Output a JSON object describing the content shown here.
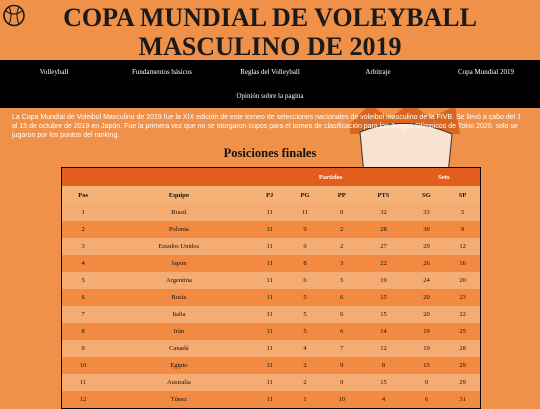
{
  "header": {
    "title": "COPA MUNDIAL DE VOLEYBALL MASCULINO DE 2019"
  },
  "nav": {
    "row1": [
      "Volleyball",
      "Fundamentos básicos",
      "Reglas del Volleyball",
      "Arbitraje",
      "Copa Mundial 2019"
    ],
    "row2": "Opinión sobre la pagina"
  },
  "intro": "La Copa Mundial de Voleibol Masculino de 2019 fue la XIX edición de este torneo de selecciones nacionales de voleibol masculino de la FIVB. Se llevó a cabo del 1 al 15 de octubre de 2019 en Japón. Fue la primera vez que no se otorgaron cupos para el torneo de clasificación para los Juegos Olímpicos de Tokio 2020, solo se jugaron por los puntos del ranking.",
  "standings": {
    "title": "Posiciones finales",
    "group_partidos": "Partidos",
    "group_sets": "Sets",
    "columns": [
      "Pos",
      "Equipo",
      "PJ",
      "PG",
      "PP",
      "PTS",
      "SG",
      "SP"
    ],
    "rows": [
      [
        "1",
        "Brasil",
        "11",
        "11",
        "0",
        "32",
        "33",
        "5"
      ],
      [
        "2",
        "Polonia",
        "11",
        "9",
        "2",
        "28",
        "30",
        "9"
      ],
      [
        "3",
        "Estados Unidos",
        "11",
        "9",
        "2",
        "27",
        "29",
        "12"
      ],
      [
        "4",
        "Japón",
        "11",
        "8",
        "3",
        "22",
        "26",
        "16"
      ],
      [
        "5",
        "Argentina",
        "11",
        "6",
        "5",
        "19",
        "24",
        "20"
      ],
      [
        "6",
        "Rusia",
        "11",
        "5",
        "6",
        "15",
        "20",
        "23"
      ],
      [
        "7",
        "Italia",
        "11",
        "5",
        "6",
        "15",
        "20",
        "22"
      ],
      [
        "8",
        "Irán",
        "11",
        "5",
        "6",
        "14",
        "19",
        "25"
      ],
      [
        "9",
        "Canadá",
        "11",
        "4",
        "7",
        "12",
        "19",
        "28"
      ],
      [
        "10",
        "Egipto",
        "11",
        "2",
        "9",
        "8",
        "15",
        "29"
      ],
      [
        "11",
        "Australia",
        "11",
        "2",
        "9",
        "15",
        "9",
        "29"
      ],
      [
        "12",
        "Túnez",
        "11",
        "1",
        "10",
        "4",
        "6",
        "31"
      ]
    ]
  }
}
